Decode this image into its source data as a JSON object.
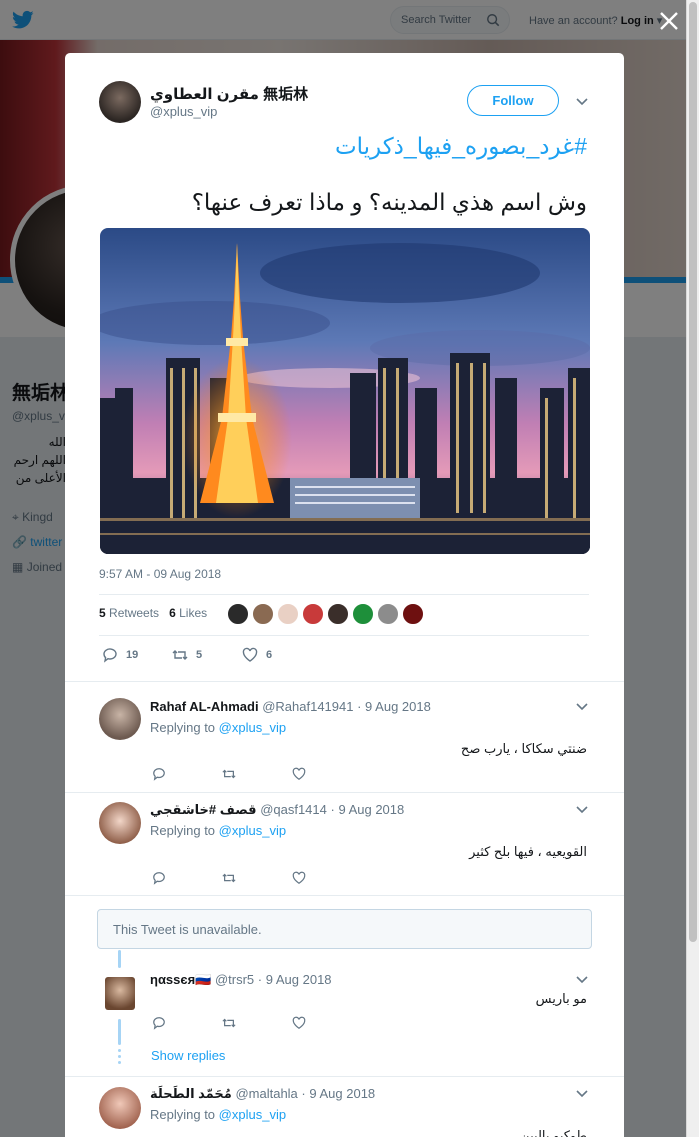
{
  "topnav": {
    "search_placeholder": "Search Twitter",
    "account_prompt": "Have an account?",
    "login_label": "Log in"
  },
  "profile": {
    "name": "無垢林",
    "handle": "@xplus_v",
    "bio_lines": [
      "الله",
      "اللهم ارحم",
      "الأعلى من"
    ],
    "location": "Kingd",
    "link": "twitter",
    "joined": "Joined"
  },
  "tweet": {
    "author_name": "مقرن العطاوي 無垢林",
    "author_handle": "@xplus_vip",
    "follow_label": "Follow",
    "hashtag": "#غرد_بصوره_فيها_ذكريات",
    "text": "وش اسم هذي المدينه؟ و ماذا تعرف عنها؟",
    "timestamp": "9:57 AM - 09 Aug 2018",
    "retweet_count": "5",
    "retweets_label": "Retweets",
    "like_count": "6",
    "likes_label": "Likes",
    "reply_action_count": "19",
    "retweet_action_count": "5",
    "like_action_count": "6",
    "image_icon": "tokyo-tower-photo"
  },
  "replies": [
    {
      "name": "Rahaf AL-Ahmadi",
      "handle": "@Rahaf141941",
      "date": "· 9 Aug 2018",
      "replying_prefix": "Replying to",
      "replying_to": "@xplus_vip",
      "text": "ضنتي سكاكا ، يارب صح"
    },
    {
      "name": "قصف #خاشقجي",
      "handle": "@qasf1414",
      "date": "· 9 Aug 2018",
      "replying_prefix": "Replying to",
      "replying_to": "@xplus_vip",
      "text": "القويعيه ، فيها بلح كثير"
    },
    {
      "name": "ηαssєя🇷🇺",
      "handle": "@trsr5",
      "date": "· 9 Aug 2018",
      "text": "مو باريس"
    },
    {
      "name": "مُحَمّد الطَحلَة",
      "handle": "@maltahla",
      "date": "· 9 Aug 2018",
      "replying_prefix": "Replying to",
      "replying_to": "@xplus_vip",
      "text": "طوكيو باليبن"
    }
  ],
  "unavailable_text": "This Tweet is unavailable.",
  "show_replies_label": "Show replies",
  "colors": {
    "accent": "#1da1f2",
    "text": "#14171a",
    "muted": "#657786",
    "border": "#e6ecf0"
  }
}
